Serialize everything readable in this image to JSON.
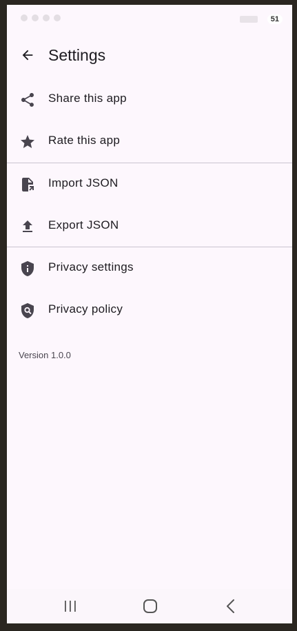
{
  "status_bar": {
    "battery": "51"
  },
  "header": {
    "title": "Settings",
    "back_icon": "arrow-back-icon"
  },
  "menu": {
    "items": [
      {
        "label": "Share this app",
        "icon": "share-icon"
      },
      {
        "label": "Rate this app",
        "icon": "star-icon"
      },
      {
        "label": "Import JSON",
        "icon": "file-import-icon"
      },
      {
        "label": "Export JSON",
        "icon": "upload-icon"
      },
      {
        "label": "Privacy settings",
        "icon": "shield-info-icon"
      },
      {
        "label": "Privacy policy",
        "icon": "shield-search-icon"
      }
    ]
  },
  "footer": {
    "version": "Version 1.0.0"
  },
  "navigation": {
    "recents_icon": "recents-icon",
    "home_icon": "home-icon",
    "back_icon": "back-chevron-icon"
  },
  "colors": {
    "background": "#fdf7fd",
    "text": "#1d1b20",
    "icon": "#49454f",
    "divider": "#cac4d0"
  }
}
